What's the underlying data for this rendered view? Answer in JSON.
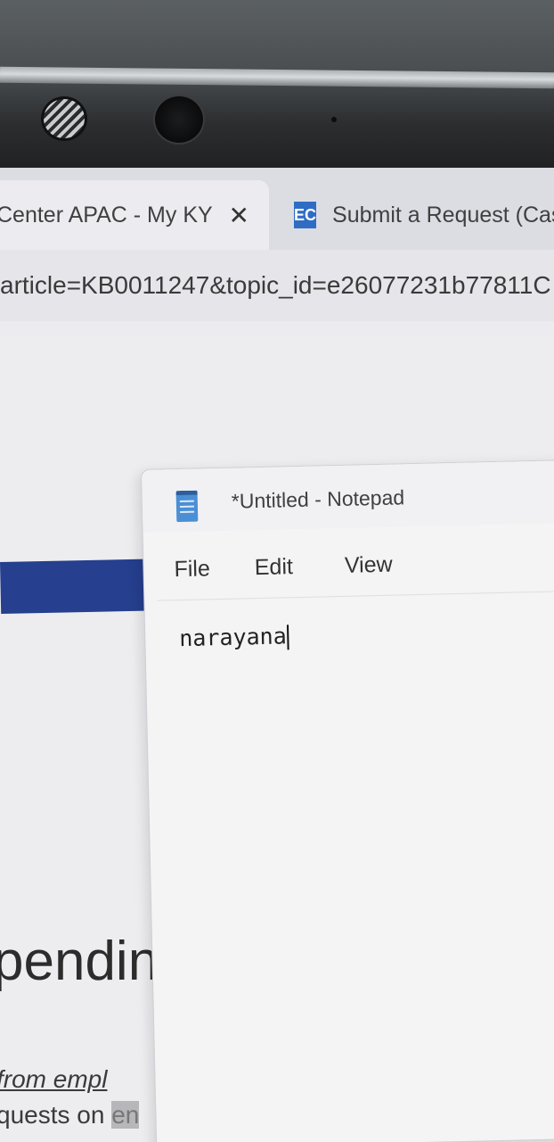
{
  "browser": {
    "tabs": [
      {
        "title": "Center APAC - My KY",
        "close_icon": "close-icon"
      },
      {
        "favicon": "EC",
        "title": "Submit a Request (Case"
      }
    ],
    "address": "article=KB0011247&topic_id=e26077231b77811C"
  },
  "page": {
    "heading_fragment": "pendin",
    "link_fragment": "from empl",
    "text_fragment": "quests on",
    "highlight_fragment": "en"
  },
  "notepad": {
    "title": "*Untitled - Notepad",
    "menu": [
      "File",
      "Edit",
      "View"
    ],
    "content": "narayana"
  }
}
